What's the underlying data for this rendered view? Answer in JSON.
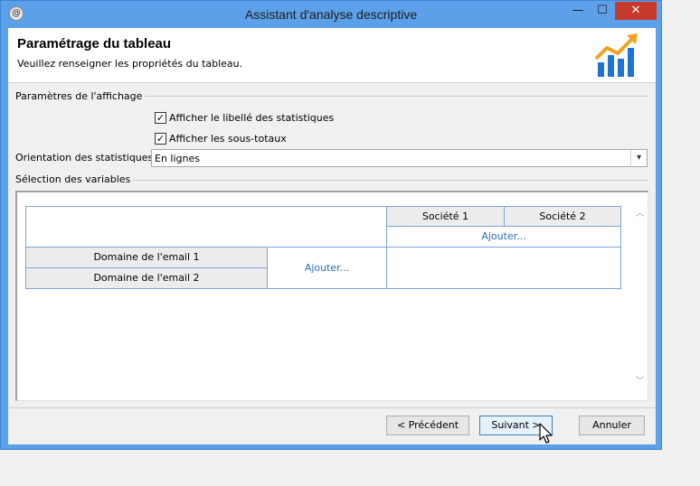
{
  "window": {
    "title": "Assistant d'analyse descriptive",
    "app_icon_glyph": "@",
    "controls": {
      "minimize": "—",
      "maximize": "☐",
      "close": "✕"
    }
  },
  "header": {
    "title": "Paramétrage du tableau",
    "subtitle": "Veuillez renseigner les propriétés du tableau.",
    "logo_icon": "chart-growth-icon",
    "logo_colors": {
      "bars": "#1f73d4",
      "arrow": "#f2a020"
    }
  },
  "display_section": {
    "label": "Paramètres de l'affichage",
    "checkboxes": [
      {
        "label": "Afficher le libellé des statistiques",
        "checked": true,
        "mark": "✓"
      },
      {
        "label": "Afficher les sous-totaux",
        "checked": true,
        "mark": "✓"
      }
    ],
    "orientation": {
      "label": "Orientation des statistiques:",
      "value": "En lignes",
      "arrow": "▾"
    }
  },
  "variables_section": {
    "label": "Sélection des variables",
    "columns": [
      "Société 1",
      "Société 2"
    ],
    "rows": [
      "Domaine de l'email 1",
      "Domaine de l'email 2"
    ],
    "add_column_label": "Ajouter...",
    "add_row_label": "Ajouter...",
    "scroll_up": "︿",
    "scroll_down": "﹀"
  },
  "footer": {
    "previous": "< Précédent",
    "next": "Suivant >",
    "cancel": "Annuler"
  },
  "colors": {
    "window_frame": "#5ba0e8",
    "close_button": "#c7392b",
    "link": "#2b6cb8",
    "grid_border": "#7fa4d6"
  }
}
